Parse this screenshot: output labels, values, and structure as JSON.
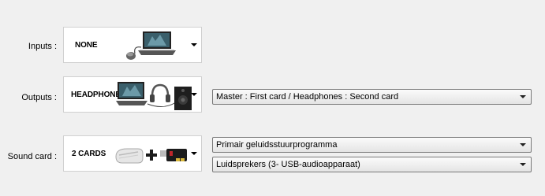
{
  "inputs": {
    "label": "Inputs :",
    "selected": "NONE"
  },
  "outputs": {
    "label": "Outputs :",
    "selected": "HEADPHONES",
    "dropdown_value": "Master : First card / Headphones : Second card"
  },
  "sound_card": {
    "label": "Sound card :",
    "selected": "2 CARDS",
    "dropdown_primary": "Primair geluidsstuurprogramma",
    "dropdown_secondary": "Luidsprekers (3- USB-audioapparaat)"
  }
}
